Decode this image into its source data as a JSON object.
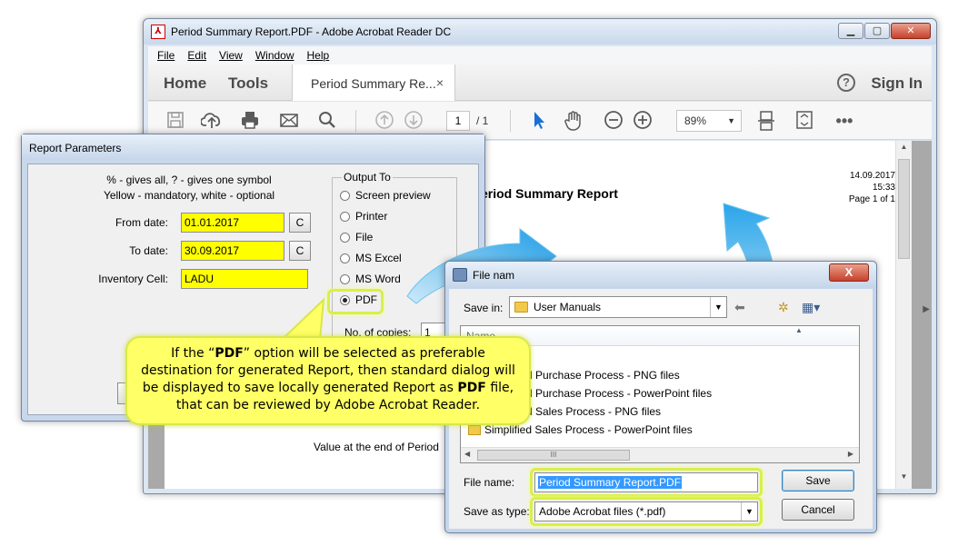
{
  "acrobat": {
    "title": "Period Summary Report.PDF - Adobe Acrobat Reader DC",
    "menu": [
      "File",
      "Edit",
      "View",
      "Window",
      "Help"
    ],
    "nav_home": "Home",
    "nav_tools": "Tools",
    "doc_tab_label": "Period Summary Re...",
    "doc_tab_close": "×",
    "help": "?",
    "sign_in": "Sign In",
    "page_current": "1",
    "page_total": "/ 1",
    "zoom": "89%",
    "report_title": "eriod Summary Report",
    "report_date": "14.09.2017",
    "report_time": "15:33",
    "report_page": "Page 1 of 1",
    "value_end": "Value at the end of Period"
  },
  "report_dialog": {
    "title": "Report Parameters",
    "hint_line1": "% - gives all, ? - gives one symbol",
    "hint_line2": "Yellow - mandatory, white - optional",
    "from_label": "From date:",
    "from_value": "01.01.2017",
    "to_label": "To date:",
    "to_value": "30.09.2017",
    "cell_label": "Inventory Cell:",
    "cell_value": "LADU",
    "c_button": "C",
    "output_group": "Output To",
    "output_options": [
      "Screen preview",
      "Printer",
      "File",
      "MS Excel",
      "MS Word",
      "PDF"
    ],
    "selected_option": "PDF",
    "copies_label": "No. of copies:",
    "copies_value": "1"
  },
  "callout": {
    "line1_pre": "If the “",
    "line1_bold": "PDF",
    "line1_post": "” option will be selected as preferable",
    "line2": "destination for generated Report, then standard dialog will",
    "line3_pre": "be displayed to save locally generated Report as ",
    "line3_bold": "PDF",
    "line3_post": " file,",
    "line4": "that can be reviewed by Adobe Acrobat Reader.",
    "fill": "#ffff66",
    "border": "#d8e848"
  },
  "save_dialog": {
    "title": "File nam",
    "close": "X",
    "save_in_label": "Save in:",
    "save_in_value": "User Manuals",
    "list_header": "Name",
    "files": [
      "d Purchase Process - PNG files",
      "d Purchase Process - PowerPoint files",
      "d Sales Process - PNG files",
      "Simplified Sales Process - PowerPoint files"
    ],
    "hscroll_grip": "III",
    "file_name_label": "File name:",
    "file_name_value": "Period Summary Report.PDF",
    "save_as_label": "Save as type:",
    "save_as_value": "Adobe Acrobat files (*.pdf)",
    "save_button": "Save",
    "cancel_button": "Cancel"
  },
  "colors": {
    "mandatory_field": "#ffff00",
    "highlight": "#d9ef4a",
    "arrow": "#2ea6e8"
  }
}
